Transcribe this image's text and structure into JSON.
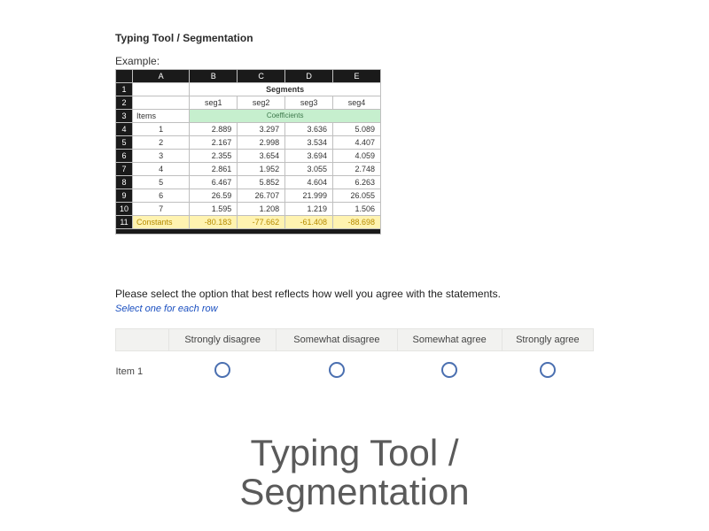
{
  "header": {
    "title": "Typing Tool / Segmentation",
    "example_label": "Example:"
  },
  "excel": {
    "col_letters": [
      "A",
      "B",
      "C",
      "D",
      "E"
    ],
    "segments_label": "Segments",
    "seg_names": [
      "seg1",
      "seg2",
      "seg3",
      "seg4"
    ],
    "items_label": "Items",
    "coef_label": "Coefficients",
    "rows": [
      {
        "idx": "1",
        "v": [
          "2.889",
          "3.297",
          "3.636",
          "5.089"
        ]
      },
      {
        "idx": "2",
        "v": [
          "2.167",
          "2.998",
          "3.534",
          "4.407"
        ]
      },
      {
        "idx": "3",
        "v": [
          "2.355",
          "3.654",
          "3.694",
          "4.059"
        ]
      },
      {
        "idx": "4",
        "v": [
          "2.861",
          "1.952",
          "3.055",
          "2.748"
        ]
      },
      {
        "idx": "5",
        "v": [
          "6.467",
          "5.852",
          "4.604",
          "6.263"
        ]
      },
      {
        "idx": "6",
        "v": [
          "26.59",
          "26.707",
          "21.999",
          "26.055"
        ]
      },
      {
        "idx": "7",
        "v": [
          "1.595",
          "1.208",
          "1.219",
          "1.506"
        ]
      }
    ],
    "constants_label": "Constants",
    "constants": [
      "-80.183",
      "-77.662",
      "-61.408",
      "-88.698"
    ],
    "rownums": [
      "1",
      "2",
      "3",
      "4",
      "5",
      "6",
      "7",
      "8",
      "9",
      "10",
      "11"
    ]
  },
  "survey": {
    "prompt": "Please select the option that best reflects how well you agree with the statements.",
    "instruction": "Select one for each row",
    "options": [
      "Strongly disagree",
      "Somewhat disagree",
      "Somewhat agree",
      "Strongly agree"
    ],
    "items": [
      "Item 1"
    ]
  },
  "footer_title": "Typing Tool / Segmentation"
}
